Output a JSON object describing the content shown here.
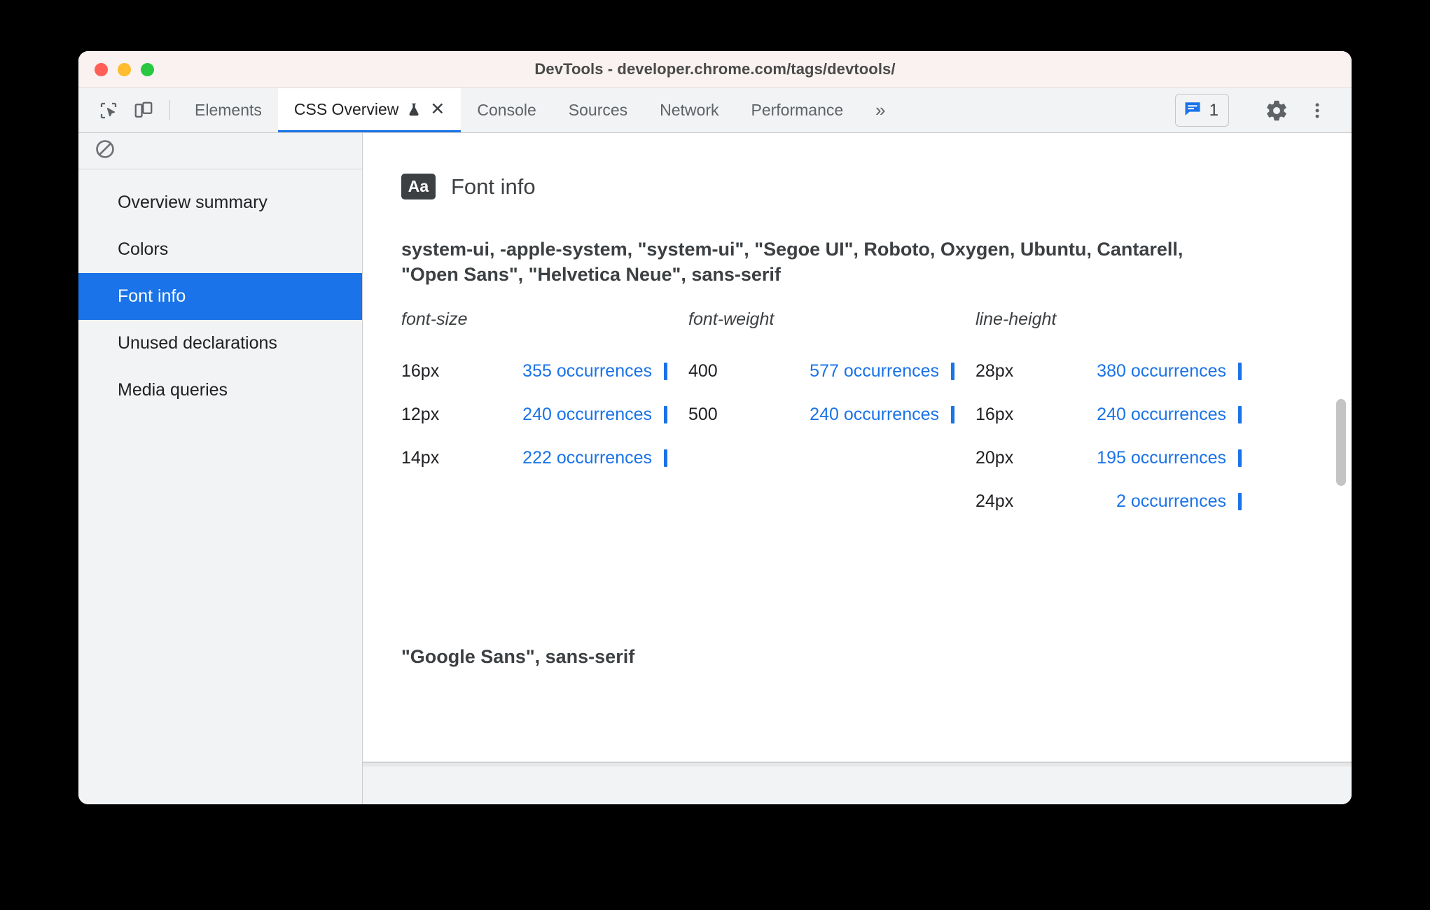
{
  "window": {
    "title": "DevTools - developer.chrome.com/tags/devtools/",
    "traffic_lights": [
      "close",
      "minimize",
      "maximize"
    ],
    "colors": {
      "accent": "#1a73e8",
      "titlebar_bg": "#f9f2f0",
      "chrome_bg": "#f1f3f4",
      "text": "#3c4043",
      "close_light": "#ff5f57",
      "min_light": "#febc2e",
      "max_light": "#28c840"
    }
  },
  "tabbar": {
    "inspect_icon": "inspect-element-icon",
    "device_icon": "device-toolbar-icon",
    "tabs": [
      {
        "label": "Elements",
        "active": false
      },
      {
        "label": "CSS Overview",
        "active": true,
        "experiment_icon": "flask-icon",
        "close_icon": "✕"
      },
      {
        "label": "Console",
        "active": false
      },
      {
        "label": "Sources",
        "active": false
      },
      {
        "label": "Network",
        "active": false
      },
      {
        "label": "Performance",
        "active": false
      }
    ],
    "more_tabs_icon": "»",
    "issues": {
      "icon": "issues-message-icon",
      "count": "1"
    },
    "settings_icon": "gear-icon",
    "menu_icon": "three-dot-menu-icon"
  },
  "sidebar": {
    "toolbar": {
      "clear_icon": "clear-overview-icon"
    },
    "items": [
      {
        "label": "Overview summary",
        "selected": false
      },
      {
        "label": "Colors",
        "selected": false
      },
      {
        "label": "Font info",
        "selected": true
      },
      {
        "label": "Unused declarations",
        "selected": false
      },
      {
        "label": "Media queries",
        "selected": false
      }
    ]
  },
  "main": {
    "section": {
      "badge": "Aa",
      "badge_icon": "font-info-icon",
      "title": "Font info"
    },
    "font_families": [
      "system-ui, -apple-system, \"system-ui\", \"Segoe UI\", Roboto, Oxygen, Ubuntu, Cantarell, \"Open Sans\", \"Helvetica Neue\", sans-serif",
      "\"Google Sans\", sans-serif"
    ],
    "metrics": [
      {
        "header": "font-size",
        "rows": [
          {
            "key": "16px",
            "value": "355 occurrences",
            "count": 355
          },
          {
            "key": "12px",
            "value": "240 occurrences",
            "count": 240
          },
          {
            "key": "14px",
            "value": "222 occurrences",
            "count": 222
          }
        ]
      },
      {
        "header": "font-weight",
        "rows": [
          {
            "key": "400",
            "value": "577 occurrences",
            "count": 577
          },
          {
            "key": "500",
            "value": "240 occurrences",
            "count": 240
          }
        ]
      },
      {
        "header": "line-height",
        "rows": [
          {
            "key": "28px",
            "value": "380 occurrences",
            "count": 380
          },
          {
            "key": "16px",
            "value": "240 occurrences",
            "count": 240
          },
          {
            "key": "20px",
            "value": "195 occurrences",
            "count": 195
          },
          {
            "key": "24px",
            "value": "2 occurrences",
            "count": 2
          }
        ]
      }
    ]
  }
}
